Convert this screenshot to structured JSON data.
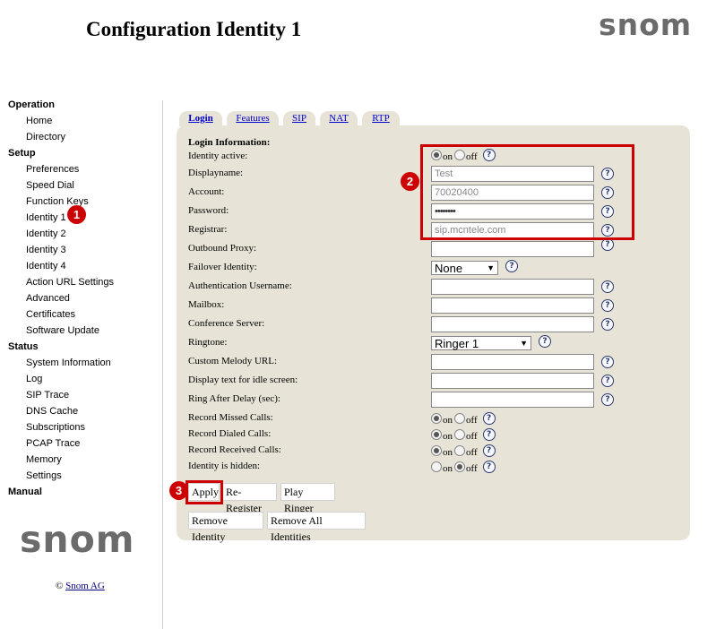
{
  "header": {
    "title": "Configuration Identity 1",
    "logo": "snom"
  },
  "sidebar": {
    "groups": [
      {
        "label": "Operation",
        "items": [
          "Home",
          "Directory"
        ]
      },
      {
        "label": "Setup",
        "items": [
          "Preferences",
          "Speed Dial",
          "Function Keys",
          "Identity 1",
          "Identity 2",
          "Identity 3",
          "Identity 4",
          "Action URL Settings",
          "Advanced",
          "Certificates",
          "Software Update"
        ]
      },
      {
        "label": "Status",
        "items": [
          "System Information",
          "Log",
          "SIP Trace",
          "DNS Cache",
          "Subscriptions",
          "PCAP Trace",
          "Memory",
          "Settings"
        ]
      },
      {
        "label": "Manual",
        "items": []
      }
    ],
    "logo": "snom",
    "copyright_symbol": "©",
    "copyright_link": "Snom AG"
  },
  "tabs": [
    {
      "label": "Login",
      "active": true
    },
    {
      "label": "Features",
      "active": false
    },
    {
      "label": "SIP",
      "active": false
    },
    {
      "label": "NAT",
      "active": false
    },
    {
      "label": "RTP",
      "active": false
    }
  ],
  "form": {
    "section_title": "Login Information:",
    "help_glyph": "?",
    "radio_on": "on",
    "radio_off": "off",
    "fields": {
      "identity_active": {
        "label": "Identity active:",
        "value": "on"
      },
      "displayname": {
        "label": "Displayname:",
        "value": "Test"
      },
      "account": {
        "label": "Account:",
        "value": "70020400"
      },
      "password": {
        "label": "Password:",
        "value": "••••••••"
      },
      "registrar": {
        "label": "Registrar:",
        "value": "sip.mcntele.com"
      },
      "outbound_proxy": {
        "label": "Outbound Proxy:",
        "value": ""
      },
      "failover_identity": {
        "label": "Failover Identity:",
        "value": "None"
      },
      "auth_username": {
        "label": "Authentication Username:",
        "value": ""
      },
      "mailbox": {
        "label": "Mailbox:",
        "value": ""
      },
      "conference_server": {
        "label": "Conference Server:",
        "value": ""
      },
      "ringtone": {
        "label": "Ringtone:",
        "value": "Ringer 1"
      },
      "custom_melody_url": {
        "label": "Custom Melody URL:",
        "value": ""
      },
      "idle_display_text": {
        "label": "Display text for idle screen:",
        "value": ""
      },
      "ring_after_delay": {
        "label": "Ring After Delay (sec):",
        "value": ""
      },
      "record_missed_calls": {
        "label": "Record Missed Calls:",
        "value": "on"
      },
      "record_dialed_calls": {
        "label": "Record Dialed Calls:",
        "value": "on"
      },
      "record_received_calls": {
        "label": "Record Received Calls:",
        "value": "on"
      },
      "identity_hidden": {
        "label": "Identity is hidden:",
        "value": "off"
      }
    }
  },
  "buttons": {
    "apply": "Apply",
    "re_register": "Re-Register",
    "play_ringer": "Play Ringer",
    "remove_identity": "Remove Identity",
    "remove_all_identities": "Remove All Identities"
  },
  "annotations": {
    "badge_1": "1",
    "badge_2": "2",
    "badge_3": "3"
  },
  "colors": {
    "panel_bg": "#e7e3d6",
    "highlight": "#cc0000",
    "link": "#0000cc",
    "logo": "#6b6b6b"
  }
}
